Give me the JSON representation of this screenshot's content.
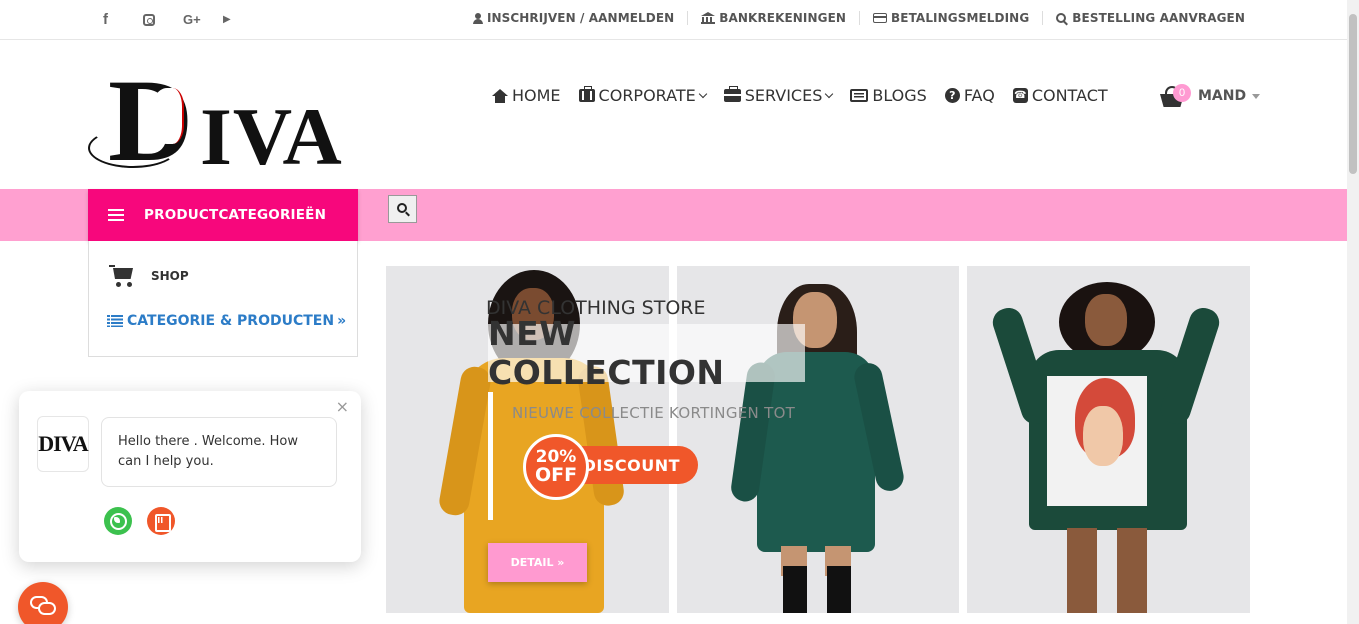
{
  "topbar": {
    "social": [
      {
        "name": "facebook",
        "glyph": "f"
      },
      {
        "name": "instagram",
        "glyph": ""
      },
      {
        "name": "google-plus",
        "glyph": "G+"
      },
      {
        "name": "youtube",
        "glyph": "▶"
      }
    ],
    "links": [
      {
        "icon": "user-icon",
        "label": "INSCHRIJVEN / AANMELDEN"
      },
      {
        "icon": "bank-icon",
        "label": "BANKREKENINGEN"
      },
      {
        "icon": "credit-card-icon",
        "label": "BETALINGSMELDING"
      },
      {
        "icon": "search-icon",
        "label": "BESTELLING AANVRAGEN"
      }
    ]
  },
  "header": {
    "logo_initial": "D",
    "logo_rest": "IVA",
    "nav": [
      {
        "icon": "home-icon",
        "label": "HOME",
        "dropdown": false
      },
      {
        "icon": "suitcase-icon",
        "label": "CORPORATE",
        "dropdown": true
      },
      {
        "icon": "briefcase-icon",
        "label": "SERVICES",
        "dropdown": true
      },
      {
        "icon": "newspaper-icon",
        "label": "BLOGS",
        "dropdown": false
      },
      {
        "icon": "question-circle-icon",
        "label": "FAQ",
        "dropdown": false
      },
      {
        "icon": "phone-icon",
        "label": "CONTACT",
        "dropdown": false
      }
    ],
    "cart": {
      "count": "0",
      "label": "MAND"
    }
  },
  "categories": {
    "button_label": "PRODUCTCATEGORIEËN",
    "shop_label": "SHOP",
    "link_label": "CATEGORIE & PRODUCTEN",
    "link_suffix": "»"
  },
  "hero": {
    "store_label": "DIVA CLOTHING STORE",
    "headline": "NEW COLLECTION",
    "subline": "NIEUWE COLLECTIE KORTINGEN TOT",
    "discount_percent": "20%",
    "discount_off": "OFF",
    "discount_label": "DISCOUNT",
    "detail_label": "DETAIL »"
  },
  "chat": {
    "avatar_text": "DIVA",
    "close": "×",
    "message": "Hello there . Welcome. How can I help you.",
    "channels": [
      "whatsapp-icon",
      "phone-icon"
    ]
  },
  "colors": {
    "pink_band": "#ffa0d0",
    "category_button": "#f7077c",
    "accent_orange": "#f0572a",
    "link_blue": "#2c7cc7",
    "cart_badge": "#ff9ad2"
  }
}
